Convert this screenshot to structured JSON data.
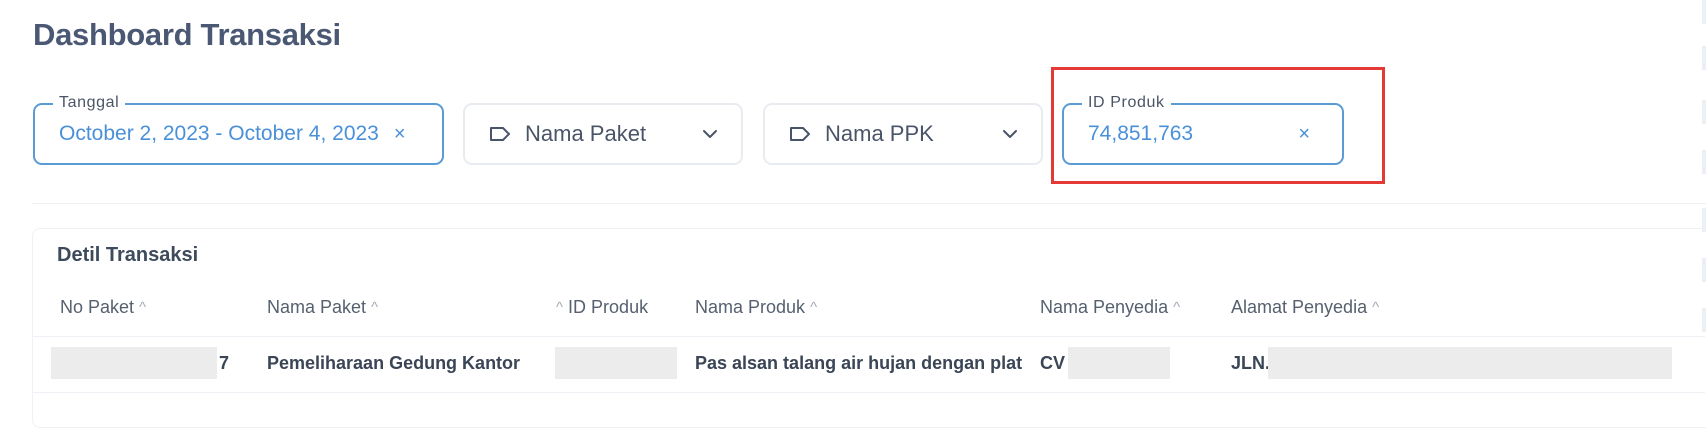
{
  "page": {
    "title": "Dashboard Transaksi"
  },
  "filters": {
    "tanggal": {
      "label": "Tanggal",
      "value": "October 2, 2023 - October 4, 2023",
      "clear": "×"
    },
    "nama_paket": {
      "placeholder": "Nama Paket",
      "icon": "tag-icon"
    },
    "nama_ppk": {
      "placeholder": "Nama PPK",
      "icon": "tag-icon"
    },
    "id_produk": {
      "label": "ID Produk",
      "value": "74,851,763",
      "clear": "×"
    }
  },
  "highlight_color": "#e53935",
  "accent_color": "#4a90d9",
  "detail": {
    "title": "Detil Transaksi",
    "columns": {
      "no_paket": "No Paket",
      "nama_paket": "Nama Paket",
      "id_produk": "ID Produk",
      "nama_produk": "Nama Produk",
      "nama_penyedia": "Nama Penyedia",
      "alamat_penyedia": "Alamat Penyedia"
    },
    "sort_glyph": "^",
    "rows": [
      {
        "no_paket_visible": "7",
        "nama_paket": "Pemeliharaan Gedung Kantor",
        "nama_produk": "Pas alsan talang air hujan dengan plat",
        "nama_penyedia_visible": "CV",
        "alamat_penyedia_visible": "JLN."
      }
    ]
  }
}
